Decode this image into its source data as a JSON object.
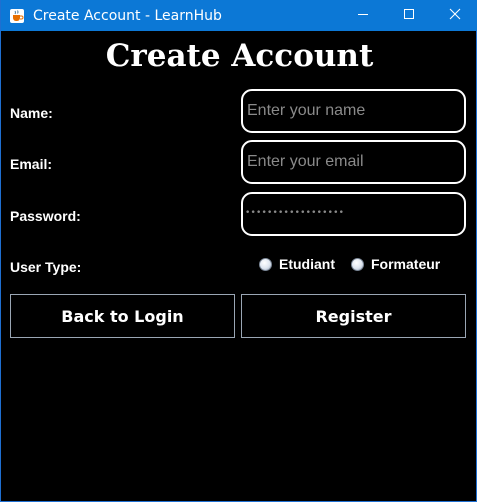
{
  "window": {
    "title": "Create Account - LearnHub",
    "app_icon": "java-cup-icon",
    "controls": {
      "minimize": "minimize-icon",
      "maximize": "maximize-icon",
      "close": "close-icon"
    },
    "titlebar_color": "#0c78d6"
  },
  "form": {
    "heading": "Create Account",
    "name": {
      "label": "Name:",
      "placeholder": "Enter your name",
      "value": ""
    },
    "email": {
      "label": "Email:",
      "placeholder": "Enter your email",
      "value": ""
    },
    "password": {
      "label": "Password:",
      "masked_value": "••••••••••••••••••"
    },
    "user_type": {
      "label": "User Type:",
      "options": [
        "Etudiant",
        "Formateur"
      ],
      "selected": null
    }
  },
  "actions": {
    "back_label": "Back to Login",
    "register_label": "Register"
  }
}
